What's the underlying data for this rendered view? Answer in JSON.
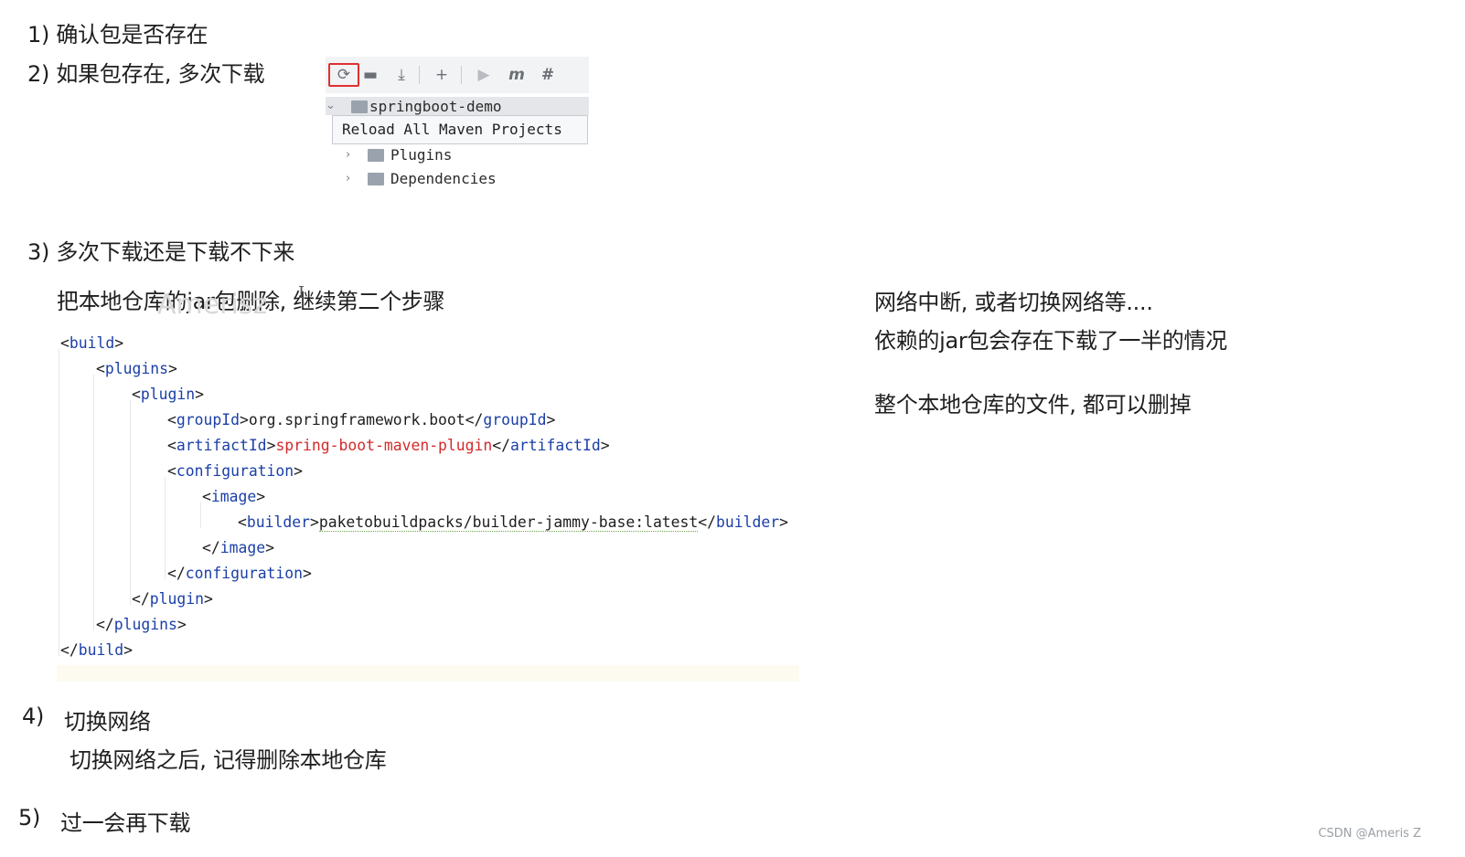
{
  "steps": {
    "s1": "1) 确认包是否存在",
    "s2": "2) 如果包存在, 多次下载",
    "s3": "3) 多次下载还是下载不下来",
    "s3_sub": "把本地仓库的jar包删除, 继续第二个步骤",
    "s4_num": "4)",
    "s4": "切换网络",
    "s4_sub": "切换网络之后, 记得删除本地仓库",
    "s5_num": "5)",
    "s5": "过一会再下载"
  },
  "notes": {
    "line1": "网络中断, 或者切换网络等....",
    "line2": "依赖的jar包会存在下载了一半的情况",
    "line3": "整个本地仓库的文件, 都可以删掉"
  },
  "ide": {
    "toolbar_icons": [
      "reload-icon",
      "folder-sync-icon",
      "download-icon",
      "add-icon",
      "run-icon",
      "maven-icon",
      "toggle-offline-icon"
    ],
    "project_name": "springboot-demo",
    "tooltip": "Reload All Maven Projects",
    "tree": [
      "Plugins",
      "Dependencies"
    ],
    "highlight_color": "#e03030"
  },
  "code": {
    "build_open": "build",
    "plugins_open": "plugins",
    "plugin_open": "plugin",
    "groupId_tag": "groupId",
    "groupId_val": "org.springframework.boot",
    "artifactId_tag": "artifactId",
    "artifactId_val": "spring-boot-maven-plugin",
    "configuration_tag": "configuration",
    "image_tag": "image",
    "builder_tag": "builder",
    "builder_val": "paketobuildpacks/builder-jammy-base:latest"
  },
  "watermark": "Amerisz",
  "credit": "CSDN @Ameris Z"
}
